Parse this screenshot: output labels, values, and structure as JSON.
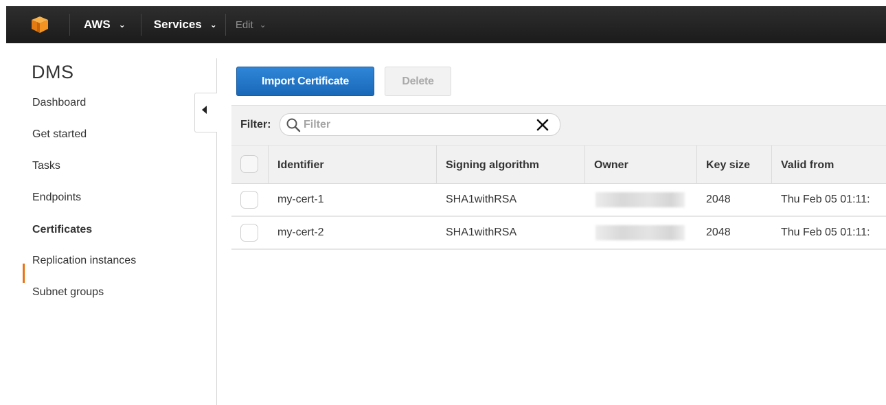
{
  "topnav": {
    "brand_label": "AWS",
    "services_label": "Services",
    "edit_label": "Edit"
  },
  "sidebar": {
    "service_title": "DMS",
    "items": [
      {
        "label": "Dashboard",
        "active": false
      },
      {
        "label": "Get started",
        "active": false
      },
      {
        "label": "Tasks",
        "active": false
      },
      {
        "label": "Endpoints",
        "active": false
      },
      {
        "label": "Certificates",
        "active": true
      },
      {
        "label": "Replication instances",
        "active": false
      },
      {
        "label": "Subnet groups",
        "active": false
      }
    ],
    "accent_color": "#ec7211"
  },
  "toolbar": {
    "import_label": "Import Certificate",
    "delete_label": "Delete"
  },
  "filter": {
    "label": "Filter:",
    "placeholder": "Filter",
    "value": ""
  },
  "table": {
    "columns": [
      "Identifier",
      "Signing algorithm",
      "Owner",
      "Key size",
      "Valid from"
    ],
    "rows": [
      {
        "identifier": "my-cert-1",
        "signing_algorithm": "SHA1withRSA",
        "owner": "",
        "key_size": "2048",
        "valid_from": "Thu Feb 05 01:11:"
      },
      {
        "identifier": "my-cert-2",
        "signing_algorithm": "SHA1withRSA",
        "owner": "",
        "key_size": "2048",
        "valid_from": "Thu Feb 05 01:11:"
      }
    ]
  },
  "colors": {
    "primary_button": "#1a68b8",
    "topbar": "#232323"
  },
  "icons": {
    "logo": "aws-cube-icon",
    "search": "search-icon",
    "clear": "close-icon",
    "collapse": "caret-left-icon"
  }
}
